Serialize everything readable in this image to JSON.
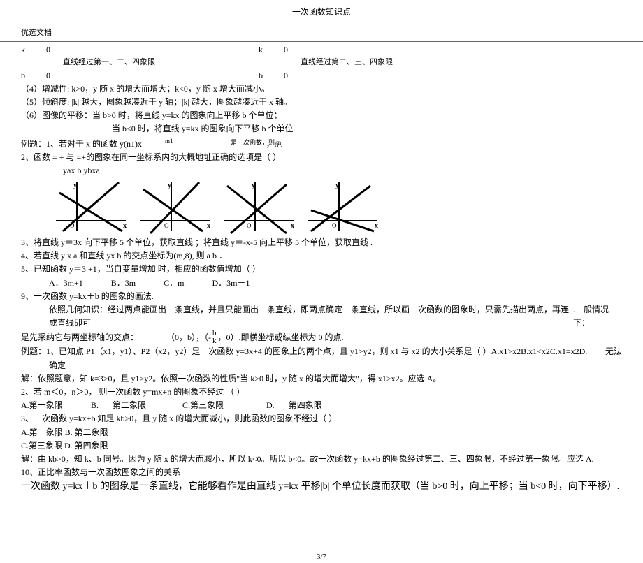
{
  "header": {
    "title": "一次函数知识点",
    "doc_label": "优选文档",
    "page_indicator": "3/7"
  },
  "kb": {
    "k1a": "k",
    "k1b": "0",
    "k2a": "k",
    "k2b": "0",
    "b1a": "b",
    "b1b": "0",
    "b2a": "b",
    "b2b": "0",
    "cap1": "直线经过第一、二、四象限",
    "cap2": "直线经过第二、三、四象限"
  },
  "p4": "（4）增减性: k>0，y 随 x 的增大而增大；k<0，y 随 x 增大而减小。",
  "p5": "（5）倾斜度: |k|    越大，图象越凑近于      y 轴；|k| 越大，图象越凑近于               x 轴。",
  "p6a": "（6）图像的平移：当 b>0 时，将直线 y=kx 的图象向上平移        b 个单位；",
  "p6b": "当 b<0 时，将直线 y=kx 的图象向下平移  b 个单位.",
  "ex1_label": "例题：1、若对于 x 的函数     y(n1)x",
  "ex1_sup": "m1",
  "ex1_mid_tiny": "是一次函数，则 m",
  "ex1_tail": "，n            .",
  "ex2": "2、函数     =    +  与    =+的图象在同一坐标系内的大概地址正确的选项是（               ）",
  "ex2_sub": "yax  b     ybxa",
  "ex3": "3、将直线 y＝3x 向下平移 5   个单位，获取直线                ；将直线      y＝-x-5 向上平移  5 个单位，获取直线                    .",
  "ex4": "4、若直线     y       x   a 和直线 yx            b 的交点坐标为(m,8), 则 a       b                  ．",
  "ex5": "5、已知函数    y＝3   +1，当自变量增加       时，相应的函数值增加（          ）",
  "ex5_choices": {
    "a": "A．3m+1",
    "b": "B．3m",
    "c": "C．m",
    "d": "D．3m－1"
  },
  "p9": "9、一次函数 y=kx＋b 的图象的画法.",
  "p9_body": "依照几何知识：经过两点能画出一条直线，并且只能画出一条直线，即两点确定一条直线，所以画一次函数的图象时，只需先描出两点，再连成直线即可",
  "p9_tail": ".一般情况下：",
  "p9_line2a": "是先采纳它与两坐标轴的交点：",
  "p9_line2b": "（0，b），（-",
  "p9_line2frac_top": "b",
  "p9_line2frac_bot": "k",
  "p9_line2c": "，0）.即横坐标或纵坐标为        0 的点.",
  "exA_1": "例题：1、已知点   P1（x1，y1）、P2（x2，y2）是一次函数       y=3x+4 的图象上的两个点，且     y1>y2，则 x1 与 x2       的大小关系是（    ）A.x1>x2B.x1<x2C.x1=x2D.",
  "exA_1_right": "无法",
  "exA_1_line2": "确定",
  "exA_ans": "解：依照题意，知   k=3>0，且 y1>y2。依照一次函数的性质\"当        k>0 时，y 随 x 的增大而增大\"，得 x1>x2。应选 A。",
  "exA_2": "2、若 m＜0，n＞0，   则一次函数 y=mx+n 的图象不经过           （       ）",
  "exA_2_choices": {
    "a": "A.第一象限",
    "b": "B.",
    "b2": "第二象限",
    "c": "C.第三象限",
    "d": "D.",
    "d2": "第四象限"
  },
  "exA_3": "3、一次函数 y=kx+b 知足 kb>0，且 y 随 x 的增大而减小，则此函数的图象不经过（            ）",
  "exA_3a": "A.第一象限 B.       第二象限",
  "exA_3b": "C.第三象限 D.       第四象限",
  "exA_sol": "解：由 kb>0，知 k、b 同号。因为 y 随 x 的增大而减小，所以 k<0。所以 b<0。故一次函数 y=kx+b 的图象经过第二、三、四象限，不经过第一象限。应选 A.",
  "p10": "10、正比率函数与一次函数图象之间的关系",
  "p10_body": "一次函数 y=kx＋b 的图象是一条直线，它能够看作是由直线 y=kx 平移|b| 个单位长度而获取（当 b>0 时，向上平移；当 b<0 时，向下平移）.",
  "chart_data": {
    "type": "other",
    "note": "Four schematic coordinate-plane sketches each showing two intersecting straight lines (representing y=ax+b and y=bx+a) with different sign combinations of slopes and intercepts. Axes labeled x (right) and y (up), origin O. No numeric ticks."
  }
}
